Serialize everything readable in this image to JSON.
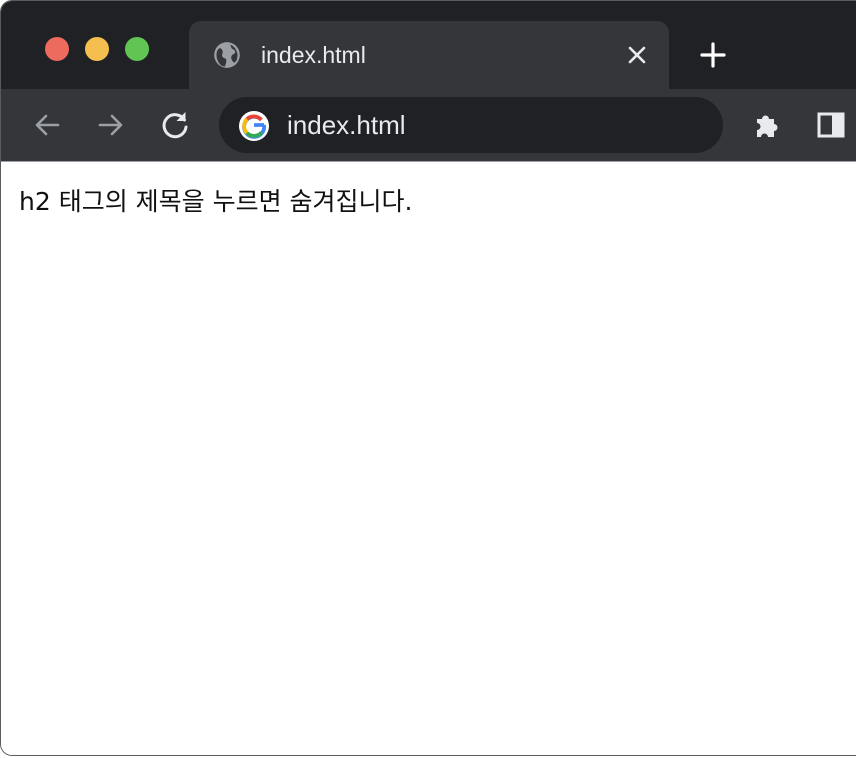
{
  "window": {
    "traffic_lights": {
      "close_color": "#ed6a5e",
      "minimize_color": "#f5bf4f",
      "zoom_color": "#61c554"
    }
  },
  "tab": {
    "title": "index.html",
    "favicon": "globe-icon",
    "close_icon": "close-icon"
  },
  "new_tab_icon": "plus-icon",
  "toolbar": {
    "back_icon": "arrow-left-icon",
    "forward_icon": "arrow-right-icon",
    "reload_icon": "reload-icon",
    "extensions_icon": "puzzle-icon",
    "side_panel_icon": "side-panel-icon"
  },
  "omnibox": {
    "site_icon": "google-icon",
    "url": "index.html"
  },
  "page": {
    "text": "h2 태그의 제목을 누르면 숨겨집니다."
  },
  "colors": {
    "tabbar_bg": "#202124",
    "toolbar_bg": "#35363a",
    "omnibox_bg": "#202124",
    "text_light": "#e8eaed",
    "page_bg": "#ffffff"
  }
}
